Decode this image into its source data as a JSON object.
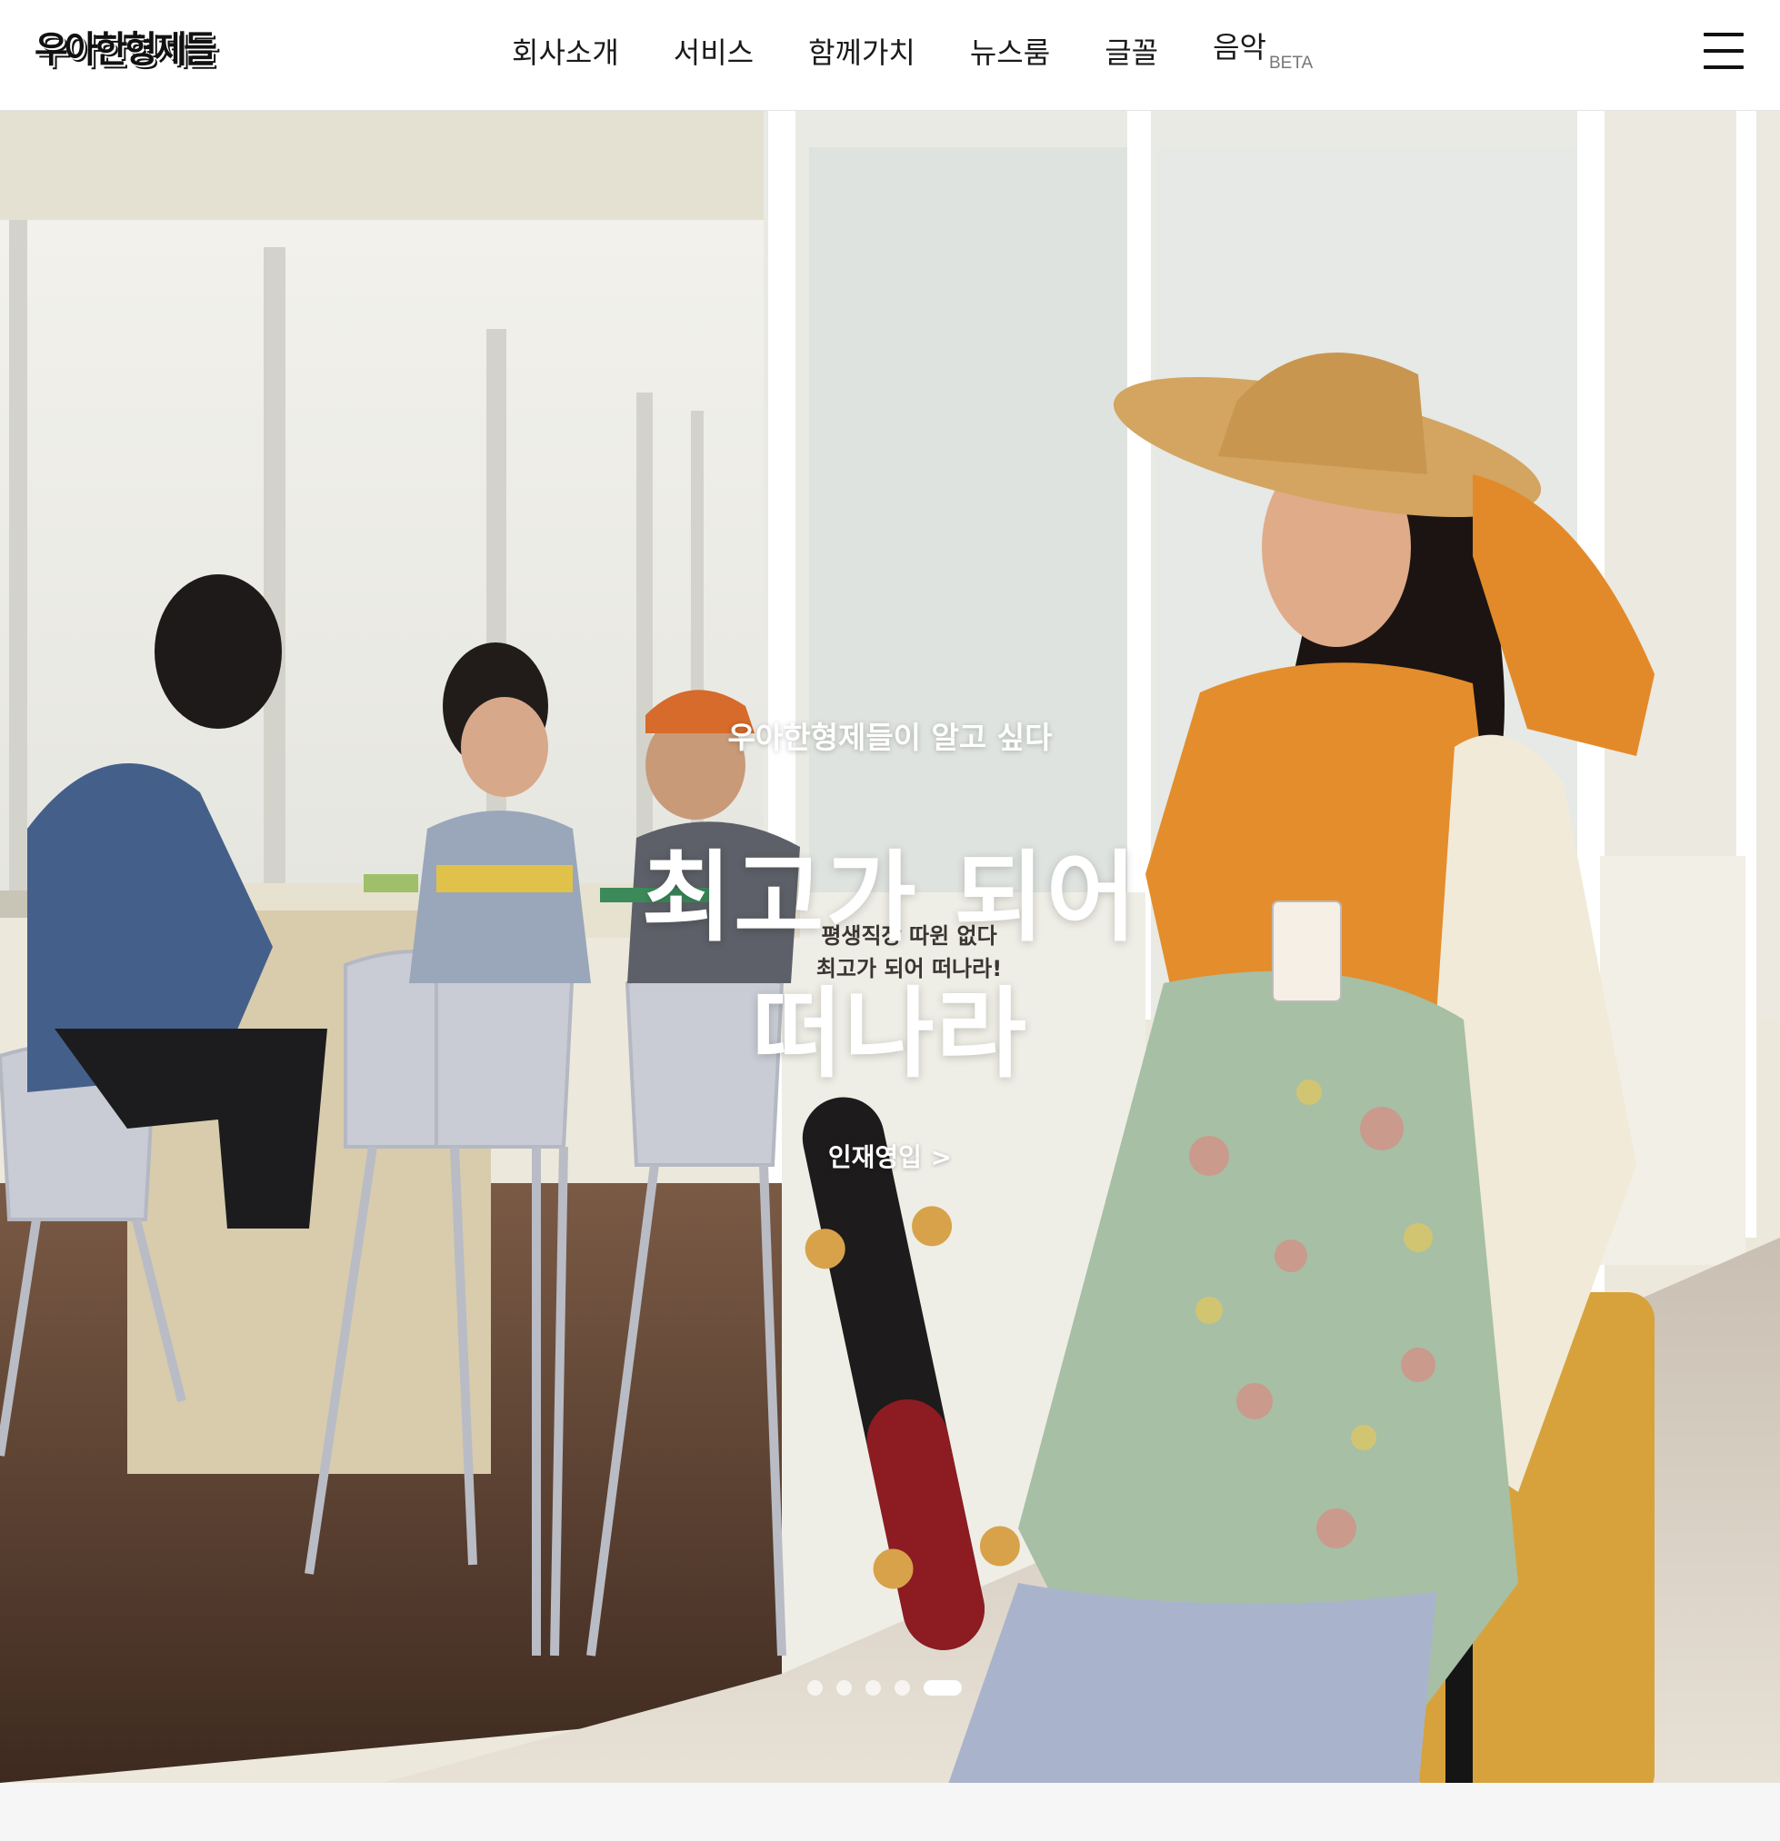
{
  "header": {
    "logo_text": "우아한형제들",
    "nav": [
      {
        "label": "회사소개"
      },
      {
        "label": "서비스"
      },
      {
        "label": "함께가치"
      },
      {
        "label": "뉴스룸"
      },
      {
        "label": "글꼴"
      },
      {
        "label": "음악",
        "badge": "BETA"
      }
    ],
    "menu_icon": "hamburger-menu-icon"
  },
  "hero": {
    "eyebrow": "우아한형제들이 알고 싶다",
    "headline_line1": "최고가 되어",
    "headline_line2": "떠나라",
    "cta_label": "인재영입 >",
    "sign_line1": "평생직장 따윈 없다",
    "sign_line2": "최고가 되어 떠나라!",
    "slides_total": 5,
    "active_slide": 5
  },
  "colors": {
    "header_bg": "#ffffff",
    "text": "#1a1a1a",
    "page_bg": "#f6f6f6",
    "hero_text": "#ffffff"
  }
}
